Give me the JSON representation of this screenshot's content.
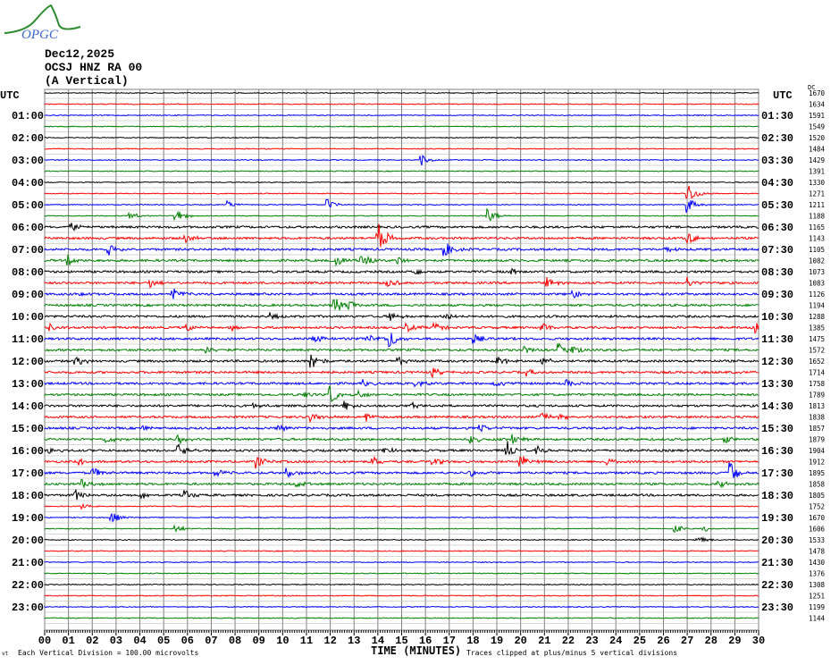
{
  "logo": {
    "text": "OPGC"
  },
  "header": {
    "date": "Dec12,2025",
    "station": "OCSJ HNZ RA 00",
    "component": "(A Vertical)"
  },
  "chart_data": {
    "type": "line",
    "title": "Dec12,2025 OCSJ HNZ RA 00 (A Vertical)",
    "xlabel": "TIME (MINUTES)",
    "xlim": [
      0,
      30
    ],
    "x_ticks": [
      "00",
      "01",
      "02",
      "03",
      "04",
      "05",
      "06",
      "07",
      "08",
      "09",
      "10",
      "11",
      "12",
      "13",
      "14",
      "15",
      "16",
      "17",
      "18",
      "19",
      "20",
      "21",
      "22",
      "23",
      "24",
      "25",
      "26",
      "27",
      "28",
      "29",
      "30"
    ],
    "left_axis_title": "UTC",
    "right_axis_title": "UTC",
    "dc_title": "DC",
    "left_labels": [
      "01:00",
      "02:00",
      "03:00",
      "04:00",
      "05:00",
      "06:00",
      "07:00",
      "08:00",
      "09:00",
      "10:00",
      "11:00",
      "12:00",
      "13:00",
      "14:00",
      "15:00",
      "16:00",
      "17:00",
      "18:00",
      "19:00",
      "20:00",
      "21:00",
      "22:00",
      "23:00"
    ],
    "right_labels": [
      "01:30",
      "02:30",
      "03:30",
      "04:30",
      "05:30",
      "06:30",
      "07:30",
      "08:30",
      "09:30",
      "10:30",
      "11:30",
      "12:30",
      "13:30",
      "14:30",
      "15:30",
      "16:30",
      "17:30",
      "18:30",
      "19:30",
      "20:30",
      "21:30",
      "22:30",
      "23:30"
    ],
    "dc_offsets": [
      1670,
      1634,
      1591,
      1549,
      1520,
      1484,
      1429,
      1391,
      1330,
      1271,
      1211,
      1188,
      1165,
      1143,
      1105,
      1082,
      1073,
      1083,
      1126,
      1194,
      1288,
      1385,
      1475,
      1572,
      1652,
      1714,
      1758,
      1789,
      1813,
      1838,
      1857,
      1879,
      1904,
      1912,
      1895,
      1858,
      1805,
      1752,
      1670,
      1606,
      1533,
      1478,
      1430,
      1376,
      1308,
      1251,
      1199,
      1144
    ],
    "trace_colors": [
      "#000000",
      "#ff0000",
      "#0000ff",
      "#008000"
    ],
    "rows": 48,
    "minutes_per_row": 30,
    "grid": true
  },
  "footer": {
    "division": "Each Vertical Division =  100.00 microvolts",
    "clipped": "Traces clipped at plus/minus 5 vertical divisions",
    "corner": "vt"
  }
}
